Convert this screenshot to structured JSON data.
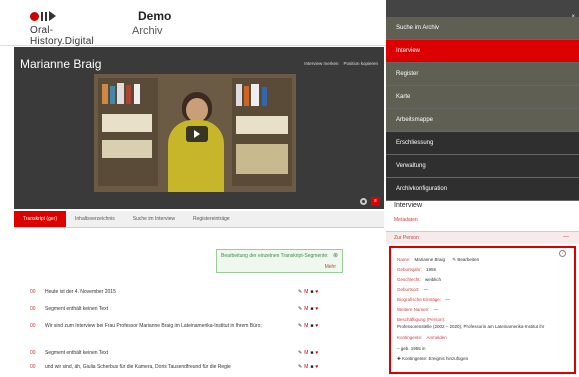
{
  "header": {
    "logo_text": "Oral-History.Digital",
    "app_name": "Demo",
    "app_sub": "Archiv"
  },
  "media": {
    "title": "Marianne Braig",
    "link_bookmark": "Interview merken",
    "link_share": "Position kopieren"
  },
  "tabs": [
    {
      "label": "Transkript (ger)",
      "active": true
    },
    {
      "label": "Inhaltsverzeichnis",
      "active": false
    },
    {
      "label": "Suche im Interview",
      "active": false
    },
    {
      "label": "Registereinträge",
      "active": false
    }
  ],
  "hint": {
    "text": "Bearbeitung der einzelnen Transkript-Segmente:",
    "more": "Mehr",
    "close": "⊗"
  },
  "segments": [
    {
      "tc": "00",
      "text": "Heute ist der 4. November 2015"
    },
    {
      "tc": "00",
      "text": "Segment enthält keinen Text"
    },
    {
      "tc": "00",
      "text": "Wir sind zum Interview bei Frau Professor Marianne Braig im Lateinamerika-Institut in Ihrem Büro;"
    },
    {
      "tc": "00",
      "text": "Segment enthält keinen Text"
    },
    {
      "tc": "00",
      "text": "und wir sind, äh, Giulia Scherbus für die Kamera, Doris Tausendfreund für die Regie"
    }
  ],
  "actions": {
    "edit": "✎",
    "mark": "M",
    "note": "■",
    "heart": "♥"
  },
  "sidebar": {
    "close": "×",
    "menu": [
      {
        "label": "Suche im Archiv",
        "state": "alt"
      },
      {
        "label": "Interview",
        "state": "active"
      },
      {
        "label": "Register",
        "state": "alt"
      },
      {
        "label": "Karte",
        "state": "alt"
      },
      {
        "label": "Arbeitsmappe",
        "state": "alt"
      },
      {
        "label": "Erschliessung",
        "state": "dark"
      },
      {
        "label": "Verwaltung",
        "state": "dark"
      },
      {
        "label": "Archivkonfiguration",
        "state": "dark"
      }
    ],
    "section_title": "Interview",
    "sub_link": "Metadaten",
    "group_title": "Zur Person",
    "group_toggle": "—",
    "person": {
      "help": "?",
      "name_label": "Name:",
      "name_value": "Marianne Braig",
      "edit_label": "Bearbeiten",
      "birth_label": "Geburtsjahr:",
      "birth_value": "1955",
      "gender_label": "Geschlecht:",
      "gender_value": "weiblich",
      "birthplace_label": "Geburtsort:",
      "birthplace_value": "—",
      "bio_label": "Biografische Einträge:",
      "bio_value": "—",
      "other_label": "Weitere Namen:",
      "other_value": "—",
      "job_label": "Beschäftigung (Person):",
      "job_value": "Professorenstelle (2002 – 2020), Professorin am Lateinamerika-Institut ihr",
      "contrib_label": "Kontingente:",
      "contrib_value": "Anmelden",
      "extra_1": "– geb. 1955 in",
      "extra_2": "✚ Kontingente: Ereignis hinzufügen"
    }
  }
}
